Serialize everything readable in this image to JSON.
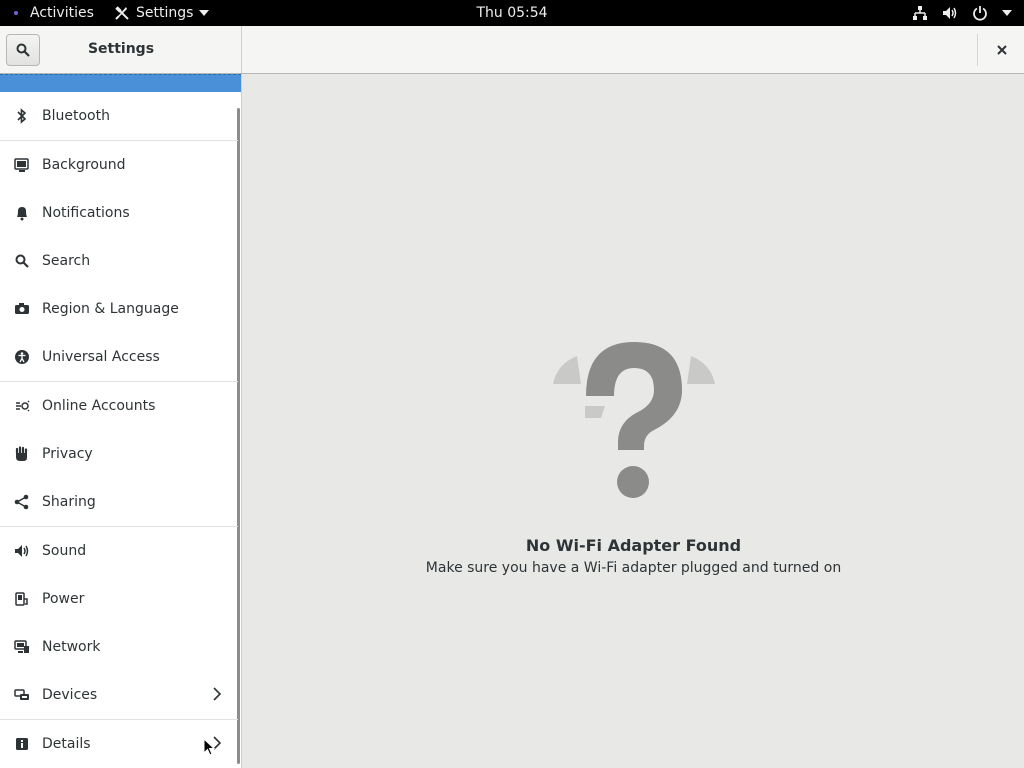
{
  "topbar": {
    "activities": "Activities",
    "app_menu": "Settings",
    "clock": "Thu 05:54"
  },
  "header": {
    "title": "Settings"
  },
  "sidebar": {
    "items": [
      {
        "label": "Bluetooth",
        "icon": "bluetooth-icon"
      },
      {
        "label": "Background",
        "icon": "background-icon"
      },
      {
        "label": "Notifications",
        "icon": "bell-icon"
      },
      {
        "label": "Search",
        "icon": "search-icon"
      },
      {
        "label": "Region & Language",
        "icon": "camera-icon"
      },
      {
        "label": "Universal Access",
        "icon": "accessibility-icon"
      },
      {
        "label": "Online Accounts",
        "icon": "online-accounts-icon"
      },
      {
        "label": "Privacy",
        "icon": "hand-icon"
      },
      {
        "label": "Sharing",
        "icon": "share-icon"
      },
      {
        "label": "Sound",
        "icon": "speaker-icon"
      },
      {
        "label": "Power",
        "icon": "power-icon"
      },
      {
        "label": "Network",
        "icon": "network-icon"
      },
      {
        "label": "Devices",
        "icon": "devices-icon"
      },
      {
        "label": "Details",
        "icon": "info-icon"
      }
    ]
  },
  "main": {
    "empty_title": "No Wi-Fi Adapter Found",
    "empty_subtitle": "Make sure you have a Wi-Fi adapter plugged and turned on"
  },
  "colors": {
    "selection": "#4a90d9",
    "topbar": "#000000",
    "background": "#e8e8e7"
  }
}
